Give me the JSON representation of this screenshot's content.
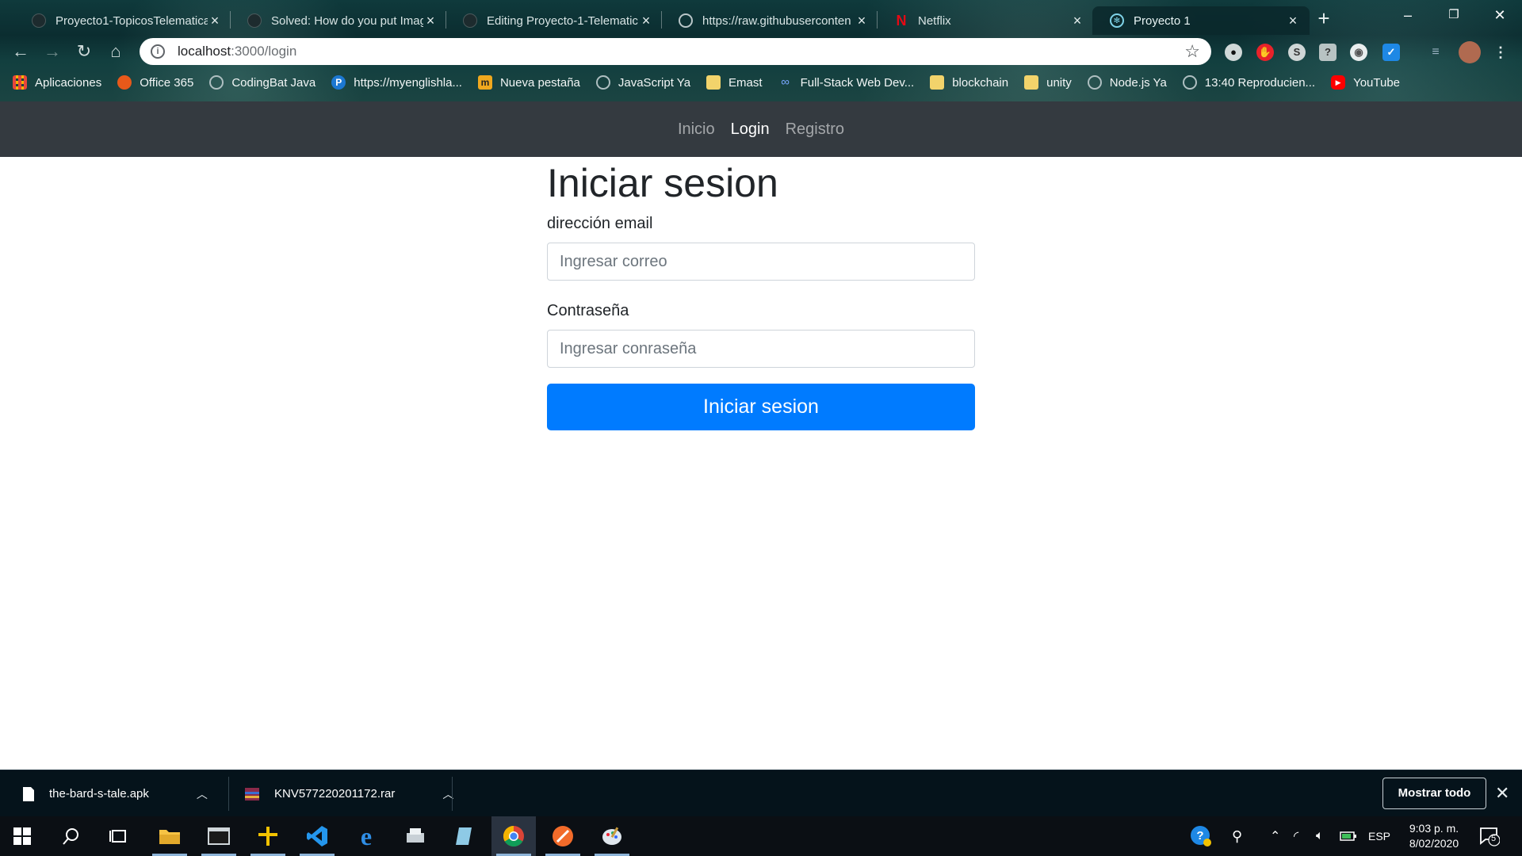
{
  "browser": {
    "tabs": [
      {
        "title": "Proyecto1-TopicosTelematica",
        "icon": "github-icon"
      },
      {
        "title": "Solved: How do you put Imag",
        "icon": "github-icon"
      },
      {
        "title": "Editing Proyecto-1-Telematic",
        "icon": "github-icon"
      },
      {
        "title": "https://raw.githubuserconten",
        "icon": "globe-icon"
      },
      {
        "title": "Netflix",
        "icon": "netflix-icon"
      },
      {
        "title": "Proyecto 1",
        "icon": "react-icon"
      }
    ],
    "active_tab_index": 5,
    "url_host": "localhost",
    "url_path": ":3000/login",
    "bookmarks": [
      {
        "label": "Aplicaciones",
        "icon": "apps-grid-icon"
      },
      {
        "label": "Office 365",
        "icon": "office-icon"
      },
      {
        "label": "CodingBat Java",
        "icon": "globe-icon"
      },
      {
        "label": "https://myenglishla...",
        "icon": "p-icon"
      },
      {
        "label": "Nueva pestaña",
        "icon": "page-icon"
      },
      {
        "label": "JavaScript Ya",
        "icon": "globe-icon"
      },
      {
        "label": "Emast",
        "icon": "folder-icon"
      },
      {
        "label": "Full-Stack Web Dev...",
        "icon": "infinity-icon"
      },
      {
        "label": "blockchain",
        "icon": "folder-icon"
      },
      {
        "label": "unity",
        "icon": "folder-icon"
      },
      {
        "label": "Node.js Ya",
        "icon": "globe-icon"
      },
      {
        "label": "13:40 Reproducien...",
        "icon": "globe-icon"
      },
      {
        "label": "YouTube",
        "icon": "youtube-icon"
      }
    ]
  },
  "page": {
    "nav": [
      {
        "label": "Inicio",
        "active": false
      },
      {
        "label": "Login",
        "active": true
      },
      {
        "label": "Registro",
        "active": false
      }
    ],
    "title": "Iniciar sesion",
    "email_label": "dirección email",
    "email_placeholder": "Ingresar correo",
    "password_label": "Contraseña",
    "password_placeholder": "Ingresar conraseña",
    "submit_label": "Iniciar sesion"
  },
  "downloads": {
    "items": [
      {
        "name": "the-bard-s-tale.apk"
      },
      {
        "name": "KNV577220201172.rar"
      }
    ],
    "show_all_label": "Mostrar todo"
  },
  "taskbar": {
    "language": "ESP",
    "time": "9:03 p. m.",
    "date": "8/02/2020",
    "notification_count": "5"
  },
  "colors": {
    "primary": "#007bff",
    "navbar": "#343a40"
  }
}
